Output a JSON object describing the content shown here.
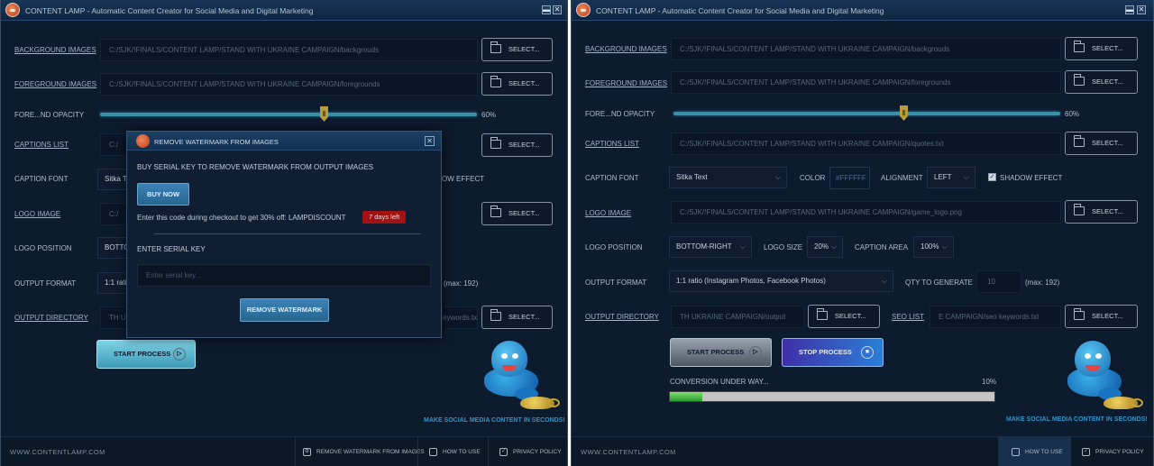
{
  "app": {
    "title": "CONTENT LAMP - Automatic Content Creator for Social Media and Digital Marketing",
    "minimize": "▬",
    "close": "✕"
  },
  "form_labels": {
    "background_images": "BACKGROUND IMAGES",
    "foreground_images": "FOREGROUND IMAGES",
    "foreground_opacity": "FORE...ND OPACITY",
    "captions_list": "CAPTIONS LIST",
    "caption_font": "CAPTION FONT",
    "logo_image": "LOGO IMAGE",
    "logo_position": "LOGO POSITION",
    "output_format": "OUTPUT FORMAT",
    "output_directory": "OUTPUT DIRECTORY",
    "color": "COLOR",
    "alignment": "ALIGNMENT",
    "shadow_effect": "SHADOW EFFECT",
    "logo_size": "LOGO SIZE",
    "caption_area": "CAPTION AREA",
    "qty_to_generate": "QTY TO GENERATE",
    "seo_list": "SEO LIST"
  },
  "values": {
    "background_path": "C:/SJK/!FINALS/CONTENT LAMP/STAND WITH UKRAINE CAMPAIGN/backgrouds",
    "foreground_path": "C:/SJK/!FINALS/CONTENT LAMP/STAND WITH UKRAINE CAMPAIGN/foregrounds",
    "captions_path": "C:/SJK/!FINALS/CONTENT LAMP/STAND WITH UKRAINE CAMPAIGN/quotes.txt",
    "logo_path": "C:/SJK/!FINALS/CONTENT LAMP/STAND WITH UKRAINE CAMPAIGN/game_logo.png",
    "opacity": "60%",
    "opacity_fraction": 0.6,
    "caption_font": "Sitka Text",
    "color": "#FFFFFF",
    "alignment": "LEFT",
    "shadow_effect_checked": true,
    "logo_position": "BOTTOM-RIGHT",
    "logo_size": "20%",
    "caption_area": "100%",
    "output_format": "1:1 ratio (Instagram Photos, Facebook Photos)",
    "qty": "10",
    "qty_max": "(max: 192)",
    "output_dir": "TH UKRAINE CAMPAIGN/output",
    "seo_list": "E CAMPAIGN/seo keywords.txt"
  },
  "left_partial": {
    "captions": "C:/",
    "caption_font": "Sitka T",
    "shadow": "OW EFFECT",
    "logo": "C:/",
    "logo_position": "BOTTO",
    "output_format": "1:1 rati",
    "qty_max": "(max: 192)",
    "output_dir": "TH U",
    "seo": "eywords.txt"
  },
  "buttons": {
    "select": "SELECT...",
    "start_process": "START PROCESS",
    "stop_process": "STOP PROCESS"
  },
  "status": {
    "conversion": "CONVERSION UNDER WAY...",
    "progress_text": "10%",
    "progress_fraction": 0.1
  },
  "tagline": "MAKE SOCIAL MEDIA CONTENT IN SECONDS!",
  "footer": {
    "site": "WWW.CONTENTLAMP.COM",
    "remove_watermark": "REMOVE WATERMARK FROM IMAGES",
    "how_to_use": "HOW TO USE",
    "privacy_policy": "PRIVACY POLICY"
  },
  "modal": {
    "title": "REMOVE WATERMARK FROM IMAGES",
    "buy_text": "BUY SERIAL KEY TO REMOVE WATERMARK FROM OUTPUT IMAGES",
    "buy_now": "BUY NOW",
    "discount_text": "Enter this code during checkout to get 30% off: LAMPDISCOUNT",
    "days_left": "7 days left",
    "serial_label": "ENTER SERIAL KEY",
    "serial_placeholder": "Enter serial key...",
    "remove_button": "REMOVE WATERMARK"
  },
  "colors": {
    "background": "#0d1b2f",
    "accent_blue": "#2b95c8",
    "badge_red": "#a31212",
    "progress_green": "#2c9a2c"
  },
  "icons": [
    "app-logo-icon",
    "folder-icon",
    "chevron-down-icon",
    "play-circle-icon",
    "stop-circle-icon",
    "watermark-icon",
    "book-icon",
    "shield-icon",
    "genie-mascot"
  ]
}
